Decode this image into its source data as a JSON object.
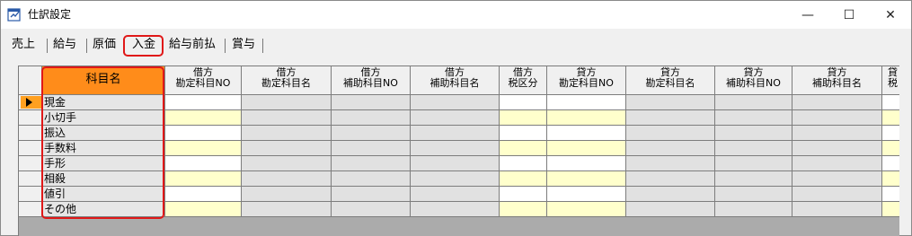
{
  "window": {
    "title": "仕訳設定",
    "controls": {
      "minimize": "—",
      "maximize": "☐",
      "close": "✕"
    }
  },
  "tabs": [
    {
      "label": "売上",
      "active": false
    },
    {
      "label": "給与",
      "active": false
    },
    {
      "label": "原価",
      "active": false
    },
    {
      "label": "入金",
      "active": true
    },
    {
      "label": "給与前払",
      "active": false
    },
    {
      "label": "賞与",
      "active": false
    }
  ],
  "grid": {
    "columns": [
      {
        "key": "name",
        "line1": "科目名",
        "line2": ""
      },
      {
        "key": "dr_main",
        "line1": "借方",
        "line2": "勘定科目NO"
      },
      {
        "key": "dr_main_name",
        "line1": "借方",
        "line2": "勘定科目名"
      },
      {
        "key": "dr_sub",
        "line1": "借方",
        "line2": "補助科目NO"
      },
      {
        "key": "dr_sub_name",
        "line1": "借方",
        "line2": "補助科目名"
      },
      {
        "key": "dr_tax",
        "line1": "借方",
        "line2": "税区分"
      },
      {
        "key": "cr_main",
        "line1": "貸方",
        "line2": "勘定科目NO"
      },
      {
        "key": "cr_main_name",
        "line1": "貸方",
        "line2": "勘定科目名"
      },
      {
        "key": "cr_sub",
        "line1": "貸方",
        "line2": "補助科目NO"
      },
      {
        "key": "cr_sub_name",
        "line1": "貸方",
        "line2": "補助科目名"
      },
      {
        "key": "cr_tax",
        "line1": "貸",
        "line2": "税"
      }
    ],
    "rows": [
      {
        "name": "現金",
        "current": true
      },
      {
        "name": "小切手",
        "current": false
      },
      {
        "name": "振込",
        "current": false
      },
      {
        "name": "手数料",
        "current": false
      },
      {
        "name": "手形",
        "current": false
      },
      {
        "name": "相殺",
        "current": false
      },
      {
        "name": "値引",
        "current": false
      },
      {
        "name": "その他",
        "current": false
      }
    ]
  },
  "colors": {
    "header_highlight": "#ff8c1a",
    "editable_odd": "#ffffff",
    "editable_even": "#ffffcc",
    "readonly": "#e1e1e1",
    "annotation": "#e01818"
  }
}
